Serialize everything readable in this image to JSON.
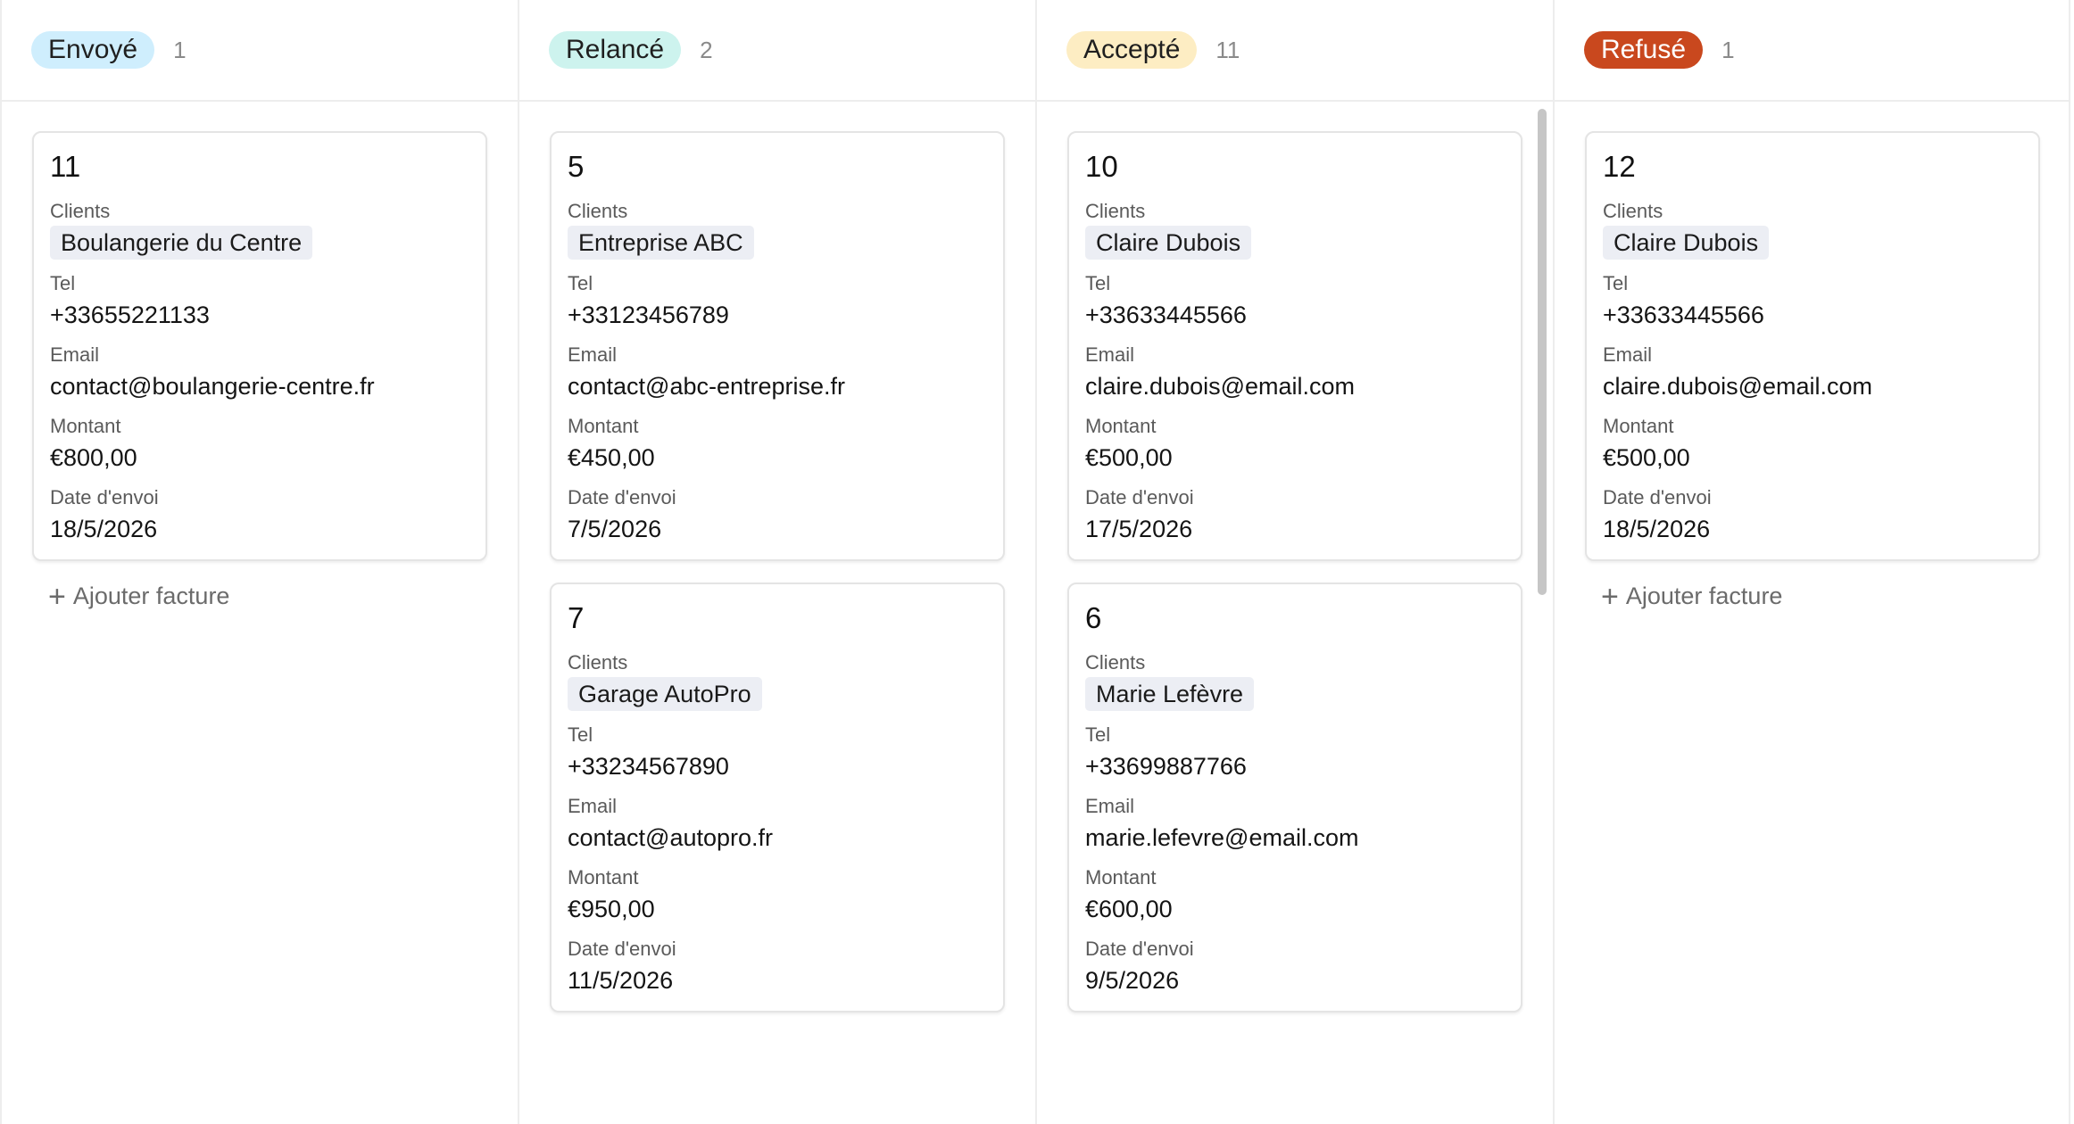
{
  "colors": {
    "envoye_bg": "#cfeefd",
    "relance_bg": "#cdf3ee",
    "accepte_bg": "#fdedc3",
    "refuse_bg": "#c9481e",
    "refuse_text": "#ffffff",
    "client_tag_bg": "#eceef4"
  },
  "labels": {
    "clients": "Clients",
    "tel": "Tel",
    "email": "Email",
    "montant": "Montant",
    "date": "Date d'envoi",
    "add": "Ajouter facture"
  },
  "columns": [
    {
      "status": "Envoyé",
      "count": "1",
      "cards": [
        {
          "id": "11",
          "client": "Boulangerie du Centre",
          "tel": "+33655221133",
          "email": "contact@boulangerie-centre.fr",
          "montant": "€800,00",
          "date": "18/5/2026"
        }
      ],
      "add_label": "Ajouter facture"
    },
    {
      "status": "Relancé",
      "count": "2",
      "cards": [
        {
          "id": "5",
          "client": "Entreprise ABC",
          "tel": "+33123456789",
          "email": "contact@abc-entreprise.fr",
          "montant": "€450,00",
          "date": "7/5/2026"
        },
        {
          "id": "7",
          "client": "Garage AutoPro",
          "tel": "+33234567890",
          "email": "contact@autopro.fr",
          "montant": "€950,00",
          "date": "11/5/2026"
        }
      ]
    },
    {
      "status": "Accepté",
      "count": "11",
      "cards": [
        {
          "id": "10",
          "client": "Claire Dubois",
          "tel": "+33633445566",
          "email": "claire.dubois@email.com",
          "montant": "€500,00",
          "date": "17/5/2026"
        },
        {
          "id": "6",
          "client": "Marie Lefèvre",
          "tel": "+33699887766",
          "email": "marie.lefevre@email.com",
          "montant": "€600,00",
          "date": "9/5/2026"
        }
      ]
    },
    {
      "status": "Refusé",
      "count": "1",
      "cards": [
        {
          "id": "12",
          "client": "Claire Dubois",
          "tel": "+33633445566",
          "email": "claire.dubois@email.com",
          "montant": "€500,00",
          "date": "18/5/2026"
        }
      ],
      "add_label": "Ajouter facture"
    }
  ]
}
